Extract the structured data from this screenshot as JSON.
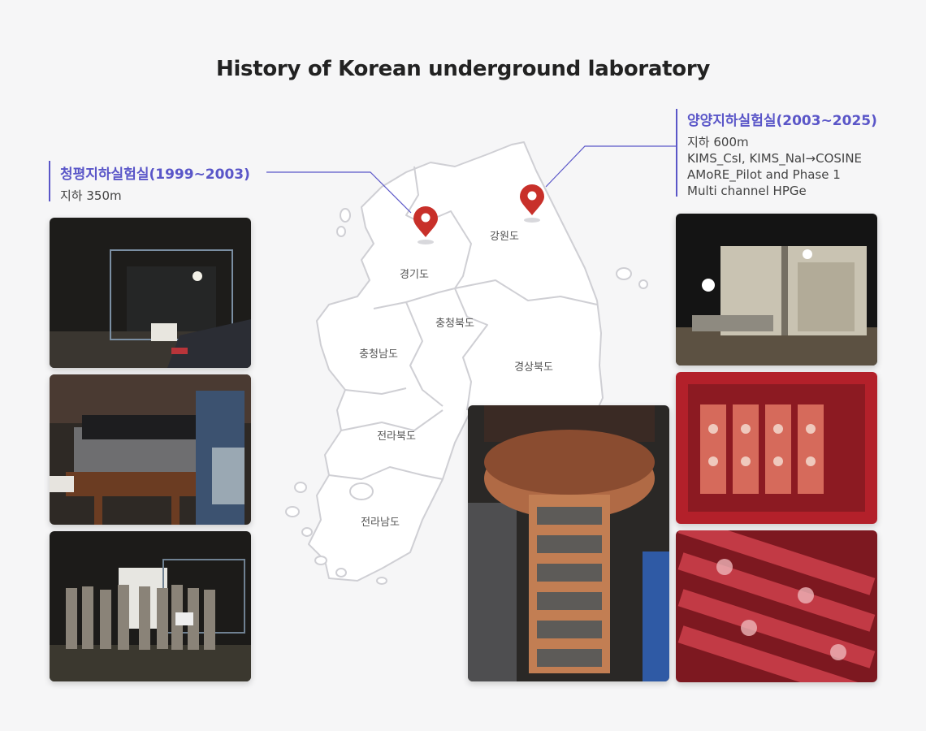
{
  "title": "History of Korean underground laboratory",
  "labs": {
    "left": {
      "name": "청평지하실험실(1999~2003)",
      "lines": [
        "지하 350m"
      ]
    },
    "right": {
      "name": "양양지하실험실(2003~2025)",
      "lines": [
        "지하 600m",
        "KIMS_CsI, KIMS_NaI→COSINE",
        "AMoRE_Pilot and Phase 1",
        "Multi channel HPGe"
      ]
    }
  },
  "map": {
    "regions": [
      "경기도",
      "강원도",
      "충청북도",
      "충청남도",
      "경상북도",
      "전라북도",
      "전라남도"
    ],
    "pin_color": "#c8302a",
    "accent_color": "#5a56c8"
  }
}
